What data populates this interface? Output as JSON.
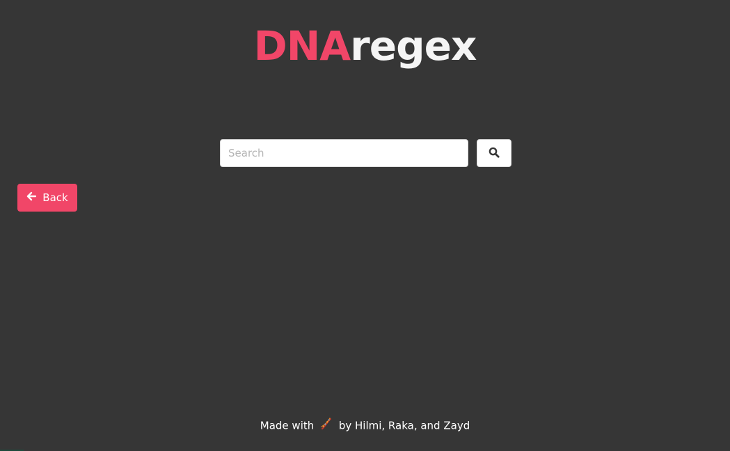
{
  "logo": {
    "part1": "DNA",
    "part2": "regex",
    "part1_color": "#f14668",
    "part2_color": "#f5f5f5"
  },
  "search": {
    "placeholder": "Search",
    "value": "",
    "button_icon": "search-icon"
  },
  "back_button": {
    "label": "Back",
    "icon": "arrow-left-icon",
    "color": "#f14668"
  },
  "footer": {
    "prefix": "Made with",
    "emoji_icon": "dna-icon",
    "suffix": "by Hilmi, Raka, and Zayd"
  },
  "theme": {
    "background": "#363636",
    "accent": "#f14668"
  }
}
